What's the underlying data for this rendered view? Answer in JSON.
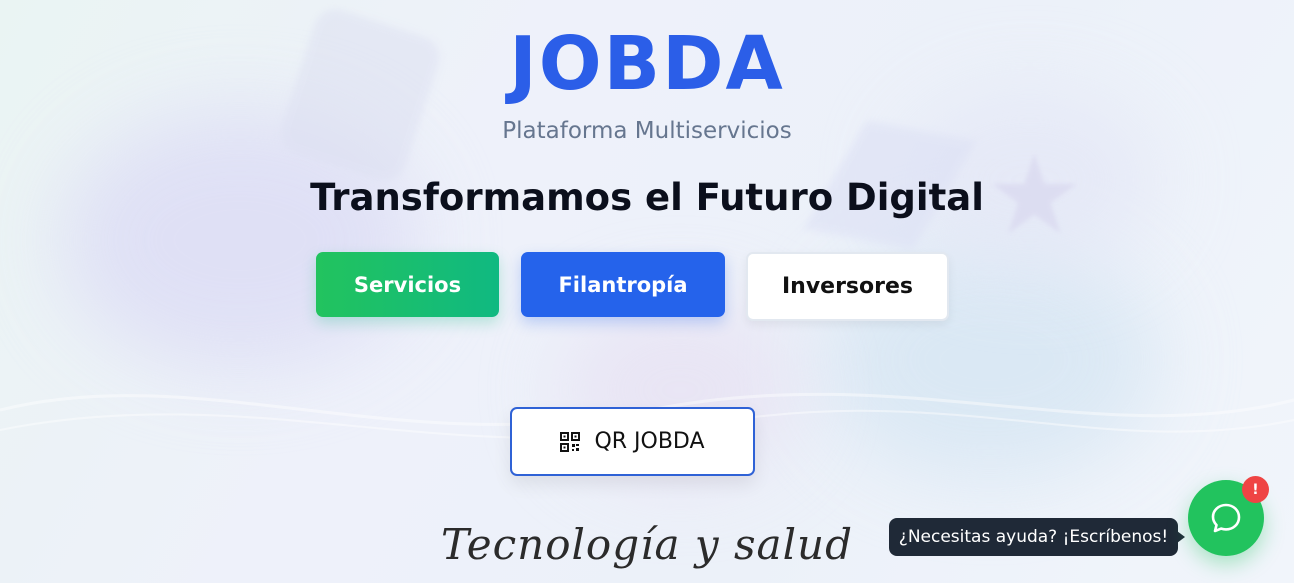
{
  "brand": {
    "logo": "JOBDA",
    "subtitle": "Plataforma Multiservicios"
  },
  "hero": {
    "headline": "Transformamos el Futuro Digital",
    "tagline": "Tecnología y salud"
  },
  "nav_buttons": {
    "servicios": "Servicios",
    "filantropia": "Filantropía",
    "inversores": "Inversores"
  },
  "qr_button": {
    "label": "QR JOBDA",
    "icon": "qr-code-icon"
  },
  "chat": {
    "tooltip": "¿Necesitas ayuda? ¡Escríbenos!",
    "badge": "!",
    "icon": "chat-bubble-icon"
  },
  "colors": {
    "brand_blue": "#2b5ee8",
    "green": "#22c35e",
    "blue_button": "#2563eb",
    "tooltip_bg": "#1f2937",
    "badge_red": "#ef4444"
  }
}
